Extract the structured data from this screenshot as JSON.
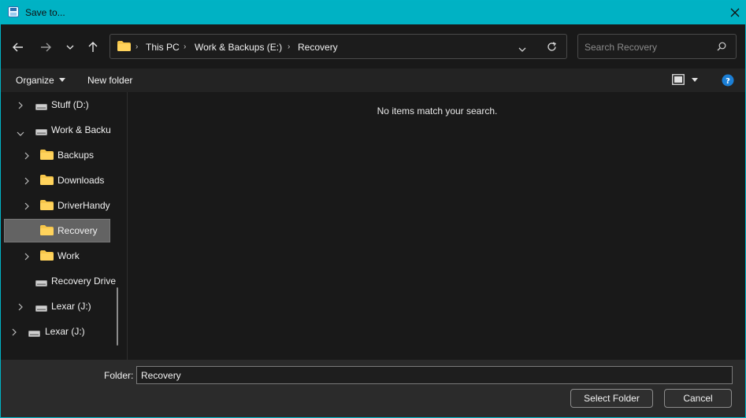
{
  "window": {
    "title": "Save to..."
  },
  "navigation": {
    "breadcrumb": [
      "This PC",
      "Work & Backups (E:)",
      "Recovery"
    ]
  },
  "search": {
    "placeholder": "Search Recovery"
  },
  "commandbar": {
    "organize": "Organize",
    "new_folder": "New folder"
  },
  "tree": [
    {
      "label": "Stuff (D:)",
      "icon": "drive-icon",
      "expanded": false
    },
    {
      "label": "Work & Backu",
      "icon": "drive-icon",
      "expanded": true
    },
    {
      "label": "Backups",
      "icon": "folder-icon",
      "expanded": false
    },
    {
      "label": "Downloads",
      "icon": "folder-icon",
      "expanded": false
    },
    {
      "label": "DriverHandy",
      "icon": "folder-icon",
      "expanded": false
    },
    {
      "label": "Recovery",
      "icon": "folder-icon",
      "selected": true
    },
    {
      "label": "Work",
      "icon": "folder-icon",
      "expanded": false
    },
    {
      "label": "Recovery Drive",
      "icon": "drive-icon"
    },
    {
      "label": "Lexar (J:)",
      "icon": "drive-icon",
      "expanded": false
    },
    {
      "label": "Lexar (J:)",
      "icon": "drive-icon",
      "expanded": false
    }
  ],
  "content": {
    "empty_message": "No items match your search."
  },
  "footer": {
    "folder_label": "Folder:",
    "folder_value": "Recovery",
    "select_button": "Select Folder",
    "cancel_button": "Cancel"
  },
  "colors": {
    "titlebar": "#00b2c4",
    "help": "#1b7fd6",
    "folder": "#f6c64a"
  }
}
